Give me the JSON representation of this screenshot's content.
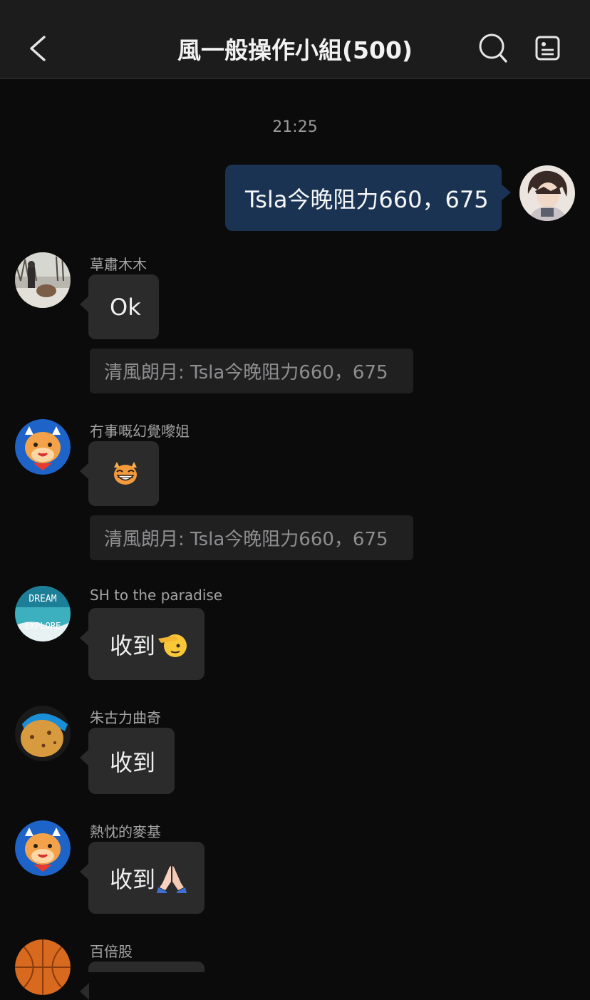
{
  "header": {
    "title": "風一般操作小組(500)",
    "back_icon": "chevron-left-icon",
    "search_icon": "search-icon",
    "note_icon": "note-icon"
  },
  "timestamp": "21:25",
  "colors": {
    "background": "#0b0b0b",
    "header": "#1c1c1d",
    "bubble_other": "#2b2b2c",
    "bubble_mine": "#1b3352",
    "quote": "#202021"
  },
  "messages": [
    {
      "type": "mine",
      "text": "Tsla今晚阻力660，675"
    },
    {
      "sender": "草肅木木",
      "text": "Ok",
      "quote": "清風朗月: Tsla今晚阻力660，675"
    },
    {
      "sender": "冇事嘅幻覺嚟姐",
      "emoji": "cow-grin-icon",
      "quote": "清風朗月: Tsla今晚阻力660，675"
    },
    {
      "sender": "SH to the paradise",
      "text": "收到",
      "emoji": "saluting-face-icon"
    },
    {
      "sender": "朱古力曲奇",
      "text": "收到"
    },
    {
      "sender": "熱忱的麥基",
      "text": "收到",
      "emoji": "folded-hands-icon"
    },
    {
      "sender": "百倍股"
    }
  ]
}
